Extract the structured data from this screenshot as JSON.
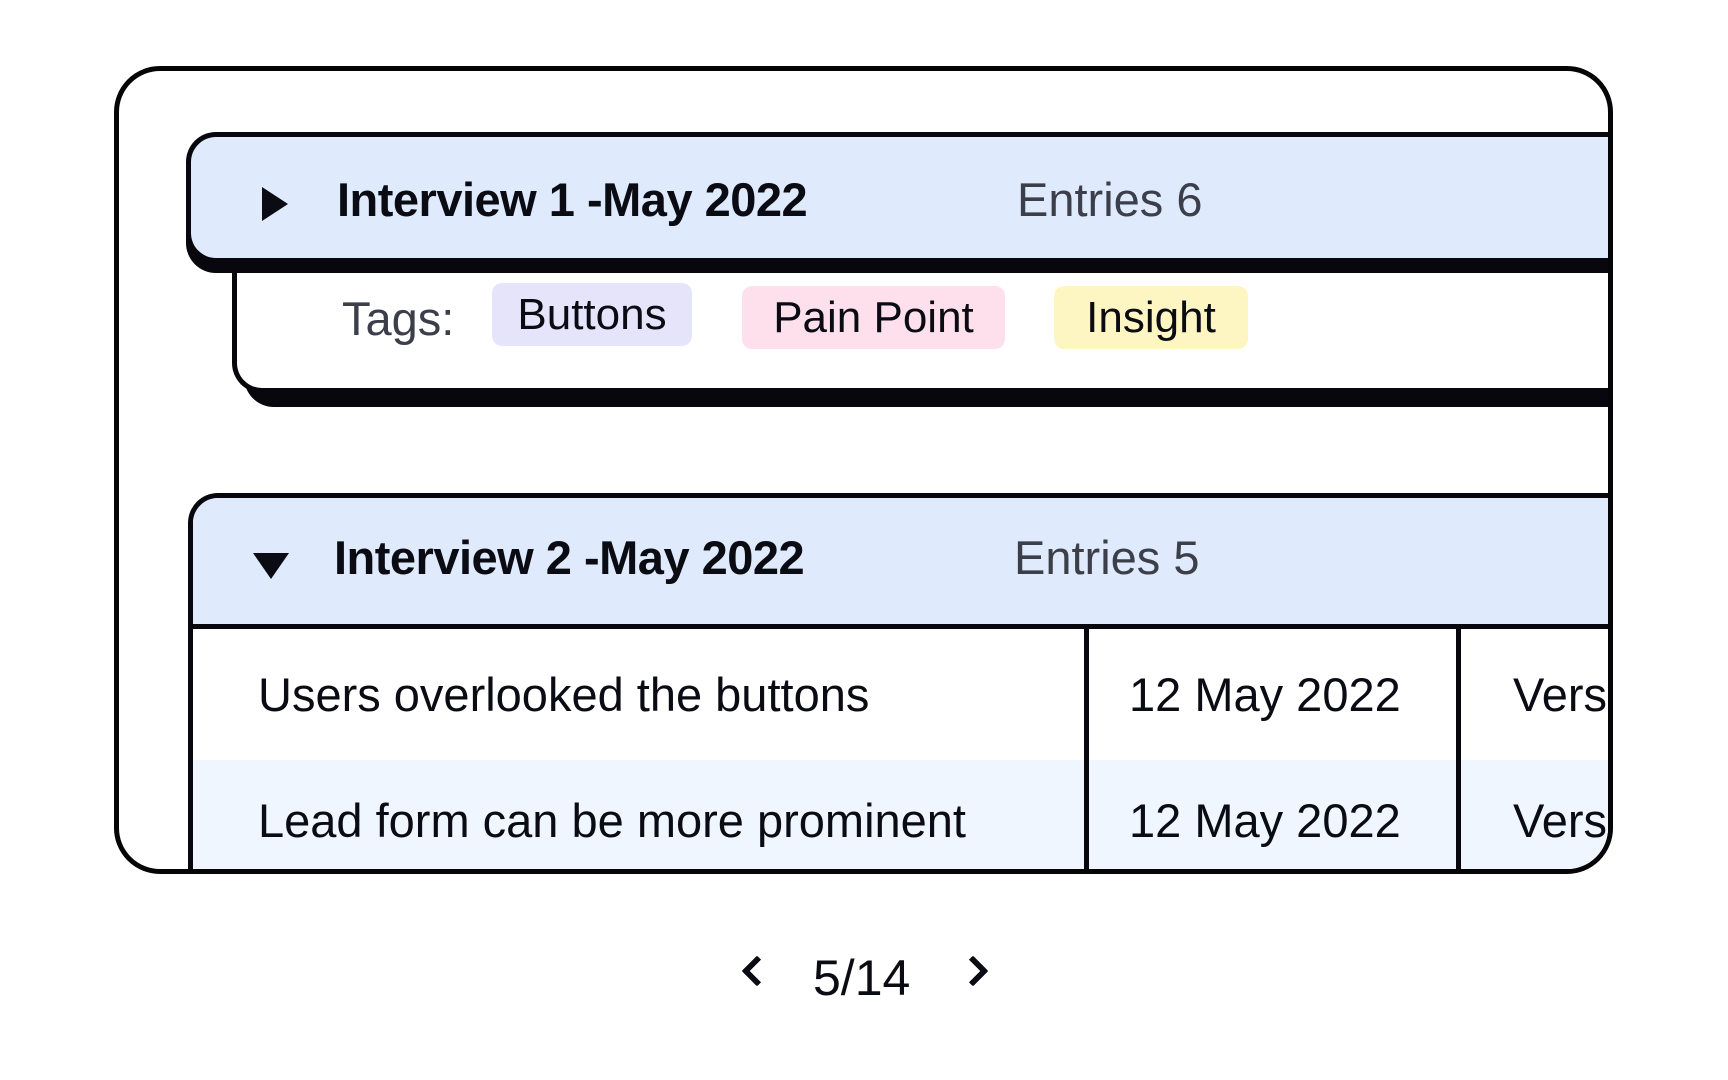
{
  "interviews": [
    {
      "title": "Interview 1 -May 2022",
      "entries_label": "Entries 6",
      "expanded": false,
      "toggle_icon": "triangle-right-icon",
      "tags_label": "Tags:",
      "tags": [
        {
          "label": "Buttons",
          "color": "#e5e4fb"
        },
        {
          "label": "Pain Point",
          "color": "#fde0ec"
        },
        {
          "label": "Insight",
          "color": "#fdf6c3"
        }
      ]
    },
    {
      "title": "Interview 2 -May 2022",
      "entries_label": "Entries 5",
      "expanded": true,
      "toggle_icon": "triangle-down-icon",
      "rows": [
        {
          "description": "Users overlooked the buttons",
          "date": "12 May 2022",
          "version": "Vers"
        },
        {
          "description": "Lead form can be more prominent",
          "date": "12 May 2022",
          "version": "Vers"
        }
      ]
    }
  ],
  "pagination": {
    "current": 5,
    "total": 14,
    "label": "5/14",
    "prev_icon": "chevron-left-icon",
    "next_icon": "chevron-right-icon"
  },
  "colors": {
    "header_bg": "#dfebfc",
    "alt_row_bg": "#eff6ff",
    "border": "#07070d"
  }
}
